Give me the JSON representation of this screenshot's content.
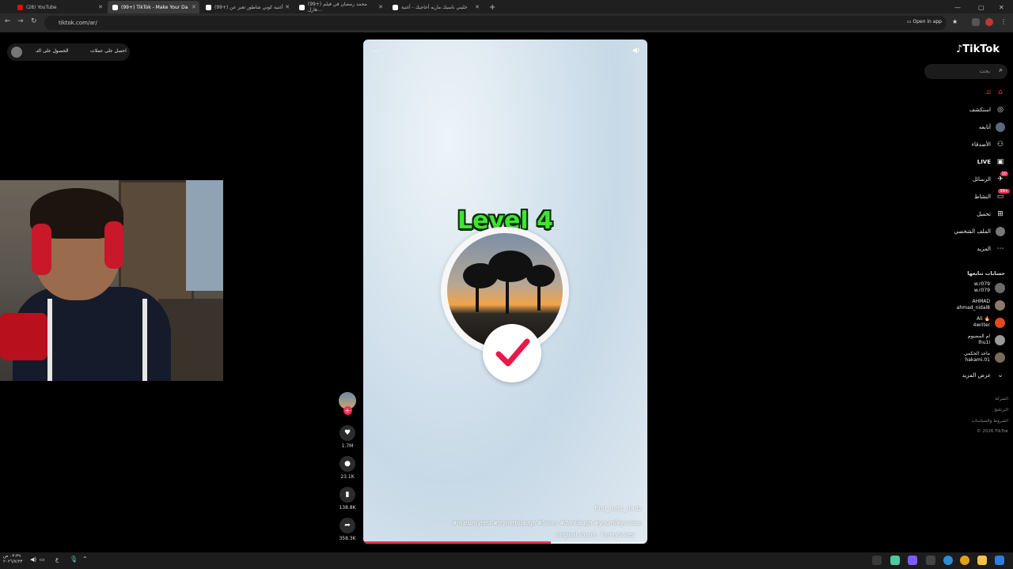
{
  "browser": {
    "tabs": [
      {
        "title": "(28) YouTube",
        "color": "#ff0000"
      },
      {
        "title": "(99+) TikTok - Make Your Da",
        "color": "#ffffff"
      },
      {
        "title": "(99+) أغنية كوني شاطور تعبر عن",
        "color": "#ffffff"
      },
      {
        "title": "(99+) محمد رمضان في فيلم هارل...",
        "color": "#ffffff"
      },
      {
        "title": "خليني ناسيك ماريه أحاجيك - أغنية",
        "color": "#ffffff"
      }
    ],
    "url": "tiktok.com/ar/",
    "open_in_app": "Open in app"
  },
  "get_app": {
    "label1": "احصل على عملات",
    "label2": "الحصول على التـ"
  },
  "video": {
    "level_text": "Level 4",
    "username": "find_best_dadz",
    "hashtags": "#maturitytest #trynottolaugh #funny #dontlaugh #youmilkyoulose",
    "sound": "original sound - Funnybonez",
    "progress": 0.66
  },
  "actions": {
    "like_count": "1.7M",
    "comment_count": "23.1K",
    "bookmark_count": "138.8K",
    "share_count": "358.3K"
  },
  "sidebar": {
    "logo": "TikTok",
    "search_placeholder": "بحث",
    "nav": [
      {
        "label": "لك",
        "icon": "home-icon"
      },
      {
        "label": "استكشف",
        "icon": "compass-icon"
      },
      {
        "label": "أتابعه",
        "icon": "avatar-icon"
      },
      {
        "label": "الأصدقاء",
        "icon": "friends-icon"
      },
      {
        "label": "LIVE",
        "icon": "live-icon"
      },
      {
        "label": "الرسائل",
        "icon": "messages-icon",
        "badge": "10"
      },
      {
        "label": "النشاط",
        "icon": "activity-icon",
        "badge": "99+"
      },
      {
        "label": "تحميل",
        "icon": "upload-icon"
      },
      {
        "label": "الملف الشخصي",
        "icon": "profile-icon"
      },
      {
        "label": "المزيد",
        "icon": "more-icon"
      }
    ],
    "following_title": "حسابات تتابعها",
    "following": [
      {
        "name": "w.r079",
        "handle": "w.r079",
        "color": "#6b6b6b"
      },
      {
        "name": "AHMAD",
        "handle": "ahmad_nidal8",
        "color": "#8a7b6b"
      },
      {
        "name": "Ali 🔥",
        "handle": "4writer",
        "color": "#e24a1a"
      },
      {
        "name": "ام المضيوم",
        "handle": "lhu1i",
        "color": "#9a9a9a"
      },
      {
        "name": "ماجد الحكمي",
        "handle": "hakami.01",
        "color": "#7a6a5a"
      }
    ],
    "see_more": "عرض المزيد",
    "footer": [
      "الشركة",
      "البرنامج",
      "الشروط والسياسات",
      "© 2026 TikTok"
    ]
  },
  "taskbar": {
    "time": "٠٣:٣٩ ص",
    "date": "٢٠٢٦/٧/٢٣"
  }
}
